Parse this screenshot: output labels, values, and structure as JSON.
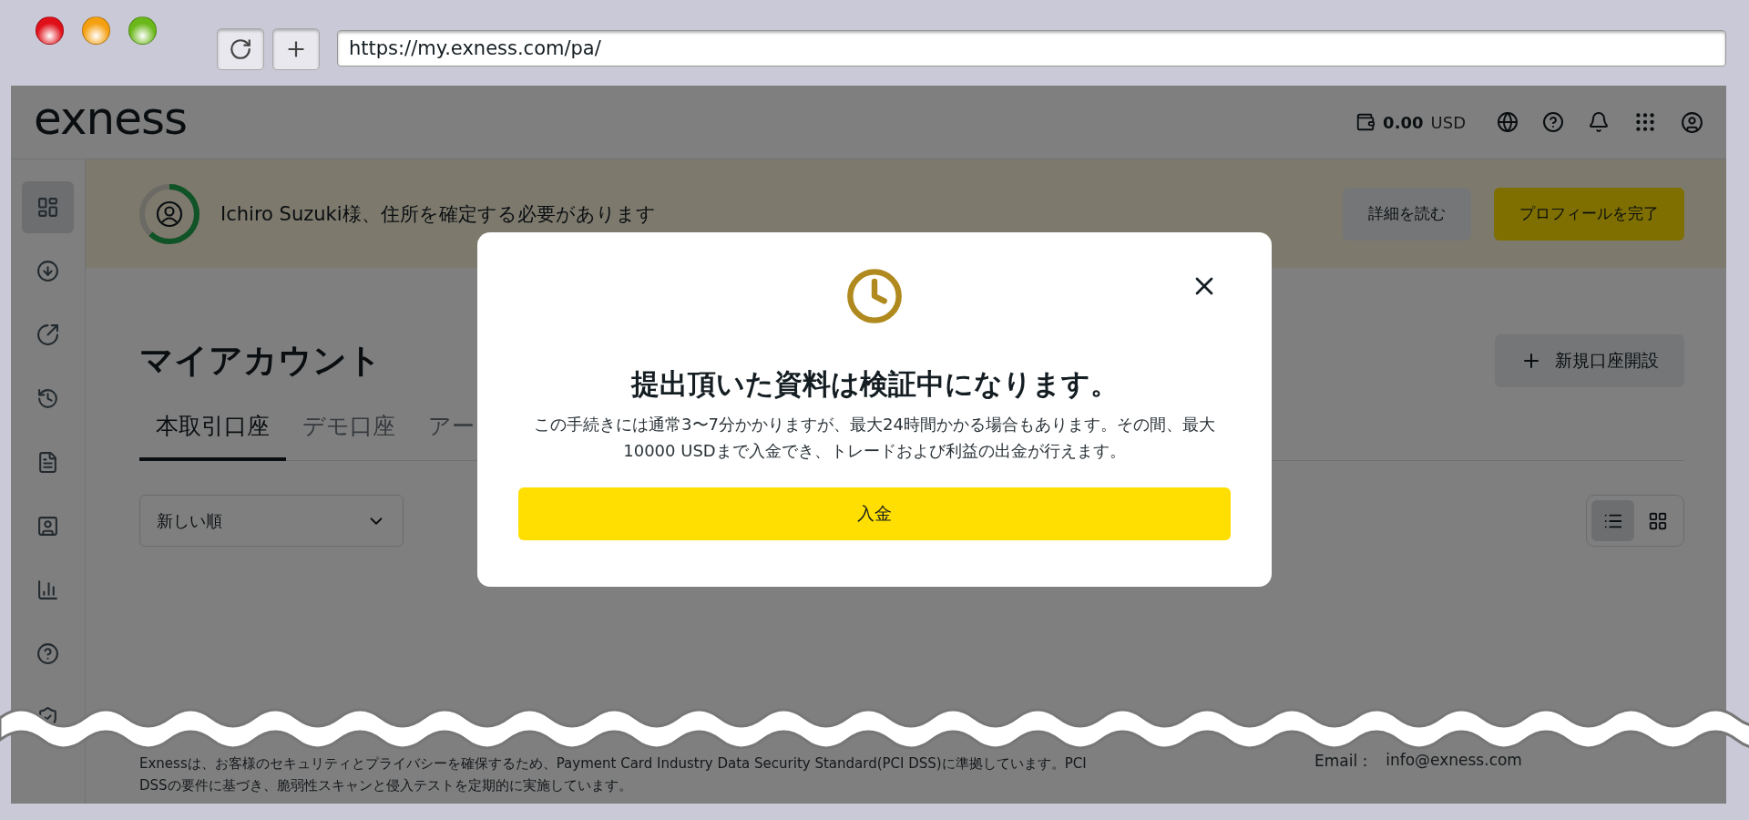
{
  "browser": {
    "url": "https://my.exness.com/pa/"
  },
  "header": {
    "logo": "exness",
    "balance": {
      "amount": "0.00",
      "currency": "USD"
    }
  },
  "sidebar": {
    "items": [
      {
        "selected": true
      },
      {
        "selected": false
      },
      {
        "selected": false
      },
      {
        "selected": false
      },
      {
        "selected": false
      },
      {
        "selected": false
      },
      {
        "selected": false
      },
      {
        "selected": false
      },
      {
        "selected": false
      }
    ]
  },
  "banner": {
    "message": "Ichiro Suzuki様、住所を確定する必要があります",
    "progress": {
      "level": 0.62
    },
    "buttons": [
      {
        "label": "詳細を読む",
        "kind": "secondary"
      },
      {
        "label": "プロフィールを完了",
        "kind": "primary"
      }
    ]
  },
  "page": {
    "title": "マイアカウント",
    "new_account_button": "新規口座開設",
    "tabs": [
      {
        "label": "本取引口座",
        "selected": true
      },
      {
        "label": "デモ口座",
        "selected": false
      },
      {
        "label": "アー",
        "selected": false
      }
    ],
    "sort": {
      "value": "新しい順"
    },
    "view_toggle": [
      {
        "kind": "list",
        "selected": true
      },
      {
        "kind": "grid",
        "selected": false
      }
    ]
  },
  "modal": {
    "title": "提出頂いた資料は検証中になります。",
    "body": "この手続きには通常3〜7分かかりますが、最大24時間かかる場合もあります。その間、最大10000 USDまで入金でき、トレードおよび利益の出金が行えます。",
    "button": "入金"
  },
  "footer": {
    "notice": "Exnessは、お客様のセキュリティとプライバシーを確保するため、Payment Card Industry Data Security Standard(PCI DSS)に準拠しています。PCI DSSの要件に基づき、脆弱性スキャンと侵入テストを定期的に実施しています。",
    "email_label": "Email：",
    "email": "info@exness.com"
  }
}
